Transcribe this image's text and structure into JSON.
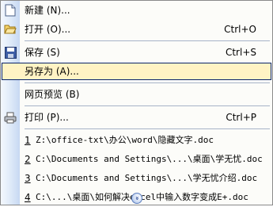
{
  "menu": {
    "items": [
      {
        "label": "新建 (N)...",
        "icon": "new-doc-icon"
      },
      {
        "label": "打开 (O)...",
        "shortcut": "Ctrl+O",
        "icon": "open-folder-icon"
      },
      {
        "label": "保存 (S)",
        "shortcut": "Ctrl+S",
        "icon": "save-floppy-icon"
      },
      {
        "label": "另存为 (A)..."
      },
      {
        "label": "网页预览 (B)"
      },
      {
        "label": "打印 (P)...",
        "shortcut": "Ctrl+P",
        "icon": "printer-icon"
      }
    ],
    "recent": [
      {
        "num": "1",
        "label": "Z:\\office-txt\\办公\\word\\隐藏文字.doc"
      },
      {
        "num": "2",
        "label": "C:\\Documents and Settings\\...\\桌面\\学无忧.doc"
      },
      {
        "num": "3",
        "label": "C:\\Documents and Settings\\...\\学无忧介绍.doc"
      },
      {
        "num": "4",
        "label": "C:\\...\\桌面\\如何解决excel中输入数字变成E+.doc"
      }
    ],
    "expand_icon": "chevron-double-down-icon",
    "highlight_color": "#fff3c4",
    "highlight_border": "#0a246a"
  }
}
